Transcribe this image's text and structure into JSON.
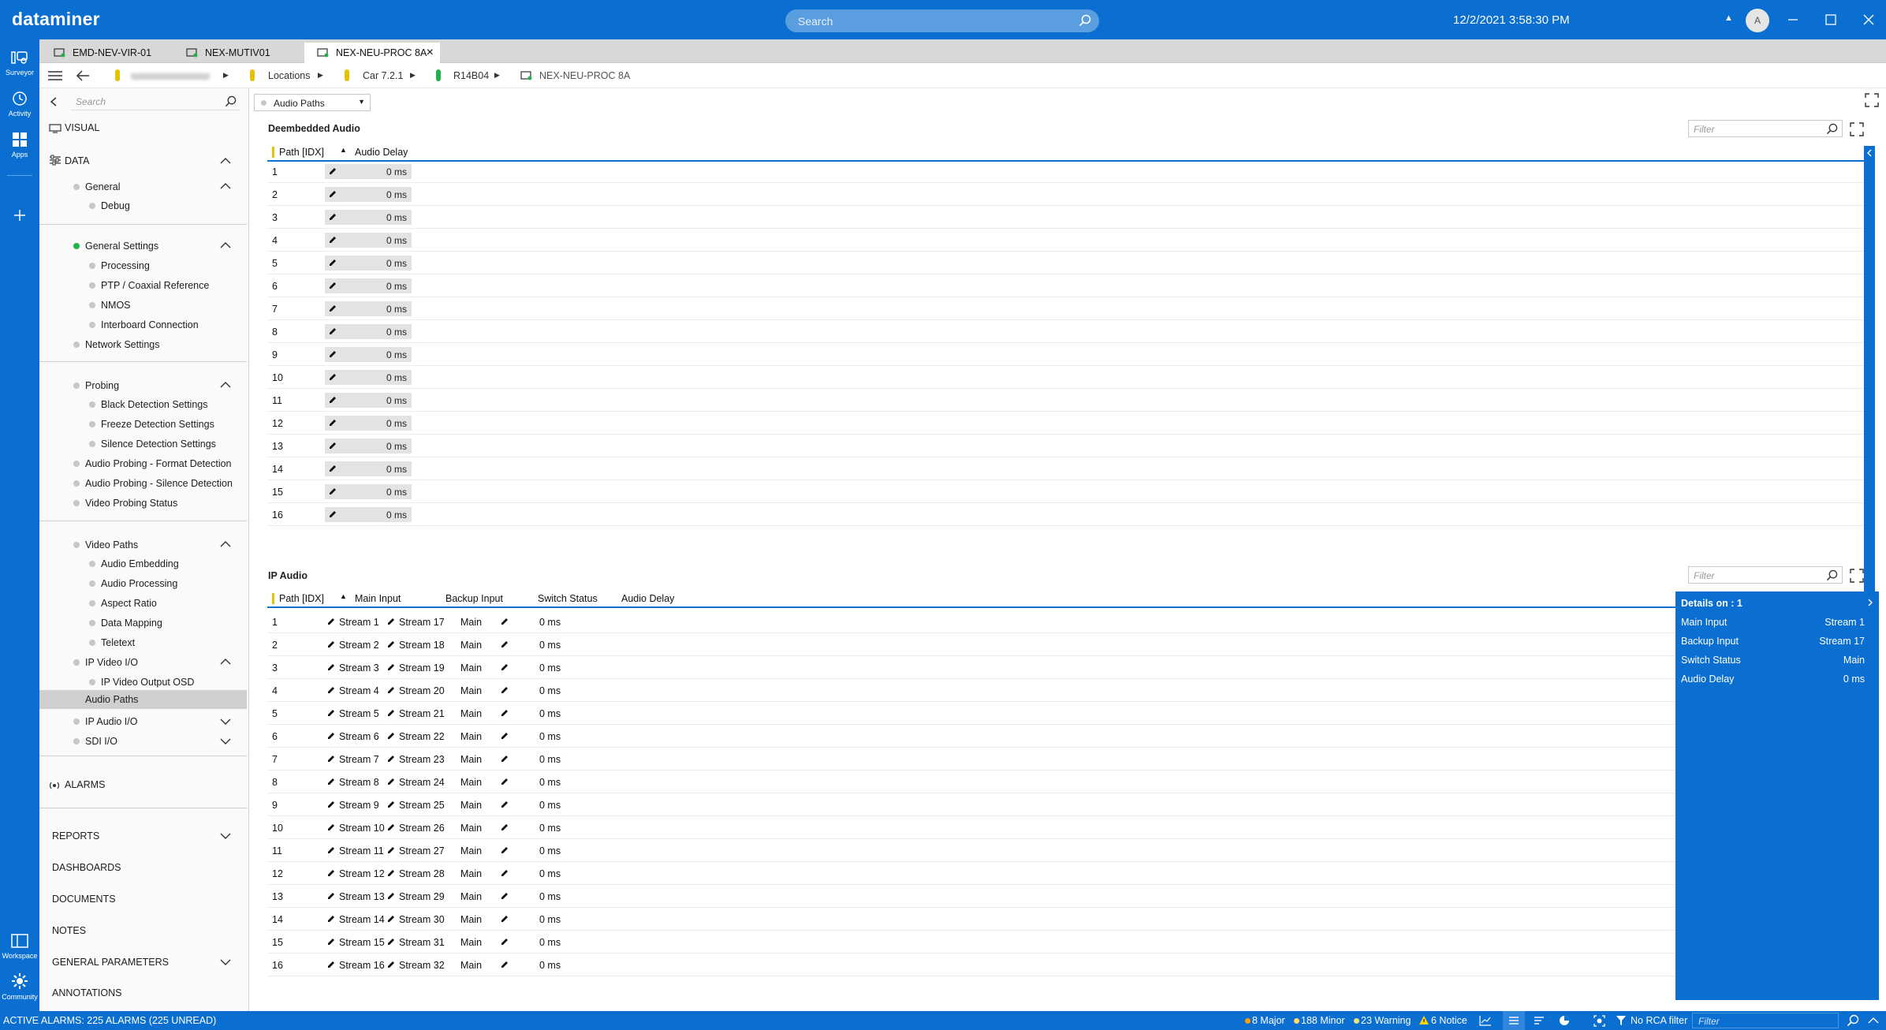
{
  "app": {
    "logo": "dataminer",
    "search_placeholder": "Search",
    "datetime": "12/2/2021 3:58:30 PM",
    "avatar_initial": "A"
  },
  "rail": {
    "top": [
      {
        "label": "Surveyor"
      },
      {
        "label": "Activity"
      },
      {
        "label": "Apps"
      }
    ],
    "bottom": [
      {
        "label": "Workspace"
      },
      {
        "label": "Community"
      }
    ]
  },
  "tabs": [
    {
      "label": "EMD-NEV-VIR-01"
    },
    {
      "label": "NEX-MUTIV01"
    },
    {
      "label": "NEX-NEU-PROC 8A",
      "active": true
    }
  ],
  "breadcrumb": [
    "Locations",
    "Car 7.2.1",
    "R14B04",
    "NEX-NEU-PROC 8A"
  ],
  "nav": {
    "search_placeholder": "Search",
    "visual": "VISUAL",
    "data": "DATA",
    "general": "General",
    "debug": "Debug",
    "general_settings": "General Settings",
    "processing": "Processing",
    "ptp": "PTP / Coaxial Reference",
    "nmos": "NMOS",
    "interboard": "Interboard Connection",
    "network": "Network Settings",
    "probing": "Probing",
    "black": "Black Detection Settings",
    "freeze": "Freeze Detection Settings",
    "silence": "Silence Detection Settings",
    "ap_format": "Audio Probing - Format Detection",
    "ap_silence": "Audio Probing - Silence Detection",
    "vp_status": "Video Probing Status",
    "video_paths": "Video Paths",
    "audio_embedding": "Audio Embedding",
    "audio_processing": "Audio Processing",
    "aspect": "Aspect Ratio",
    "data_mapping": "Data Mapping",
    "teletext": "Teletext",
    "ip_video": "IP Video I/O",
    "ip_video_osd": "IP Video Output OSD",
    "audio_paths": "Audio Paths",
    "ip_audio": "IP Audio I/O",
    "sdi": "SDI I/O",
    "alarms": "ALARMS",
    "reports": "REPORTS",
    "dashboards": "DASHBOARDS",
    "documents": "DOCUMENTS",
    "notes": "NOTES",
    "general_parameters": "GENERAL PARAMETERS",
    "annotations": "ANNOTATIONS"
  },
  "page": {
    "dropdown": "Audio Paths"
  },
  "deembedded": {
    "title": "Deembedded Audio",
    "filter_placeholder": "Filter",
    "col_path": "Path [IDX]",
    "col_delay": "Audio Delay",
    "rows": [
      {
        "idx": "1",
        "delay": "0 ms"
      },
      {
        "idx": "2",
        "delay": "0 ms"
      },
      {
        "idx": "3",
        "delay": "0 ms"
      },
      {
        "idx": "4",
        "delay": "0 ms"
      },
      {
        "idx": "5",
        "delay": "0 ms"
      },
      {
        "idx": "6",
        "delay": "0 ms"
      },
      {
        "idx": "7",
        "delay": "0 ms"
      },
      {
        "idx": "8",
        "delay": "0 ms"
      },
      {
        "idx": "9",
        "delay": "0 ms"
      },
      {
        "idx": "10",
        "delay": "0 ms"
      },
      {
        "idx": "11",
        "delay": "0 ms"
      },
      {
        "idx": "12",
        "delay": "0 ms"
      },
      {
        "idx": "13",
        "delay": "0 ms"
      },
      {
        "idx": "14",
        "delay": "0 ms"
      },
      {
        "idx": "15",
        "delay": "0 ms"
      },
      {
        "idx": "16",
        "delay": "0 ms"
      }
    ]
  },
  "ipaudio": {
    "title": "IP Audio",
    "filter_placeholder": "Filter",
    "col_path": "Path [IDX]",
    "col_main": "Main Input",
    "col_backup": "Backup Input",
    "col_switch": "Switch Status",
    "col_delay": "Audio Delay",
    "rows": [
      {
        "idx": "1",
        "main": "Stream 1",
        "backup": "Stream 17",
        "status": "Main",
        "delay": "0 ms"
      },
      {
        "idx": "2",
        "main": "Stream 2",
        "backup": "Stream 18",
        "status": "Main",
        "delay": "0 ms"
      },
      {
        "idx": "3",
        "main": "Stream 3",
        "backup": "Stream 19",
        "status": "Main",
        "delay": "0 ms"
      },
      {
        "idx": "4",
        "main": "Stream 4",
        "backup": "Stream 20",
        "status": "Main",
        "delay": "0 ms"
      },
      {
        "idx": "5",
        "main": "Stream 5",
        "backup": "Stream 21",
        "status": "Main",
        "delay": "0 ms"
      },
      {
        "idx": "6",
        "main": "Stream 6",
        "backup": "Stream 22",
        "status": "Main",
        "delay": "0 ms"
      },
      {
        "idx": "7",
        "main": "Stream 7",
        "backup": "Stream 23",
        "status": "Main",
        "delay": "0 ms"
      },
      {
        "idx": "8",
        "main": "Stream 8",
        "backup": "Stream 24",
        "status": "Main",
        "delay": "0 ms"
      },
      {
        "idx": "9",
        "main": "Stream 9",
        "backup": "Stream 25",
        "status": "Main",
        "delay": "0 ms"
      },
      {
        "idx": "10",
        "main": "Stream 10",
        "backup": "Stream 26",
        "status": "Main",
        "delay": "0 ms"
      },
      {
        "idx": "11",
        "main": "Stream 11",
        "backup": "Stream 27",
        "status": "Main",
        "delay": "0 ms"
      },
      {
        "idx": "12",
        "main": "Stream 12",
        "backup": "Stream 28",
        "status": "Main",
        "delay": "0 ms"
      },
      {
        "idx": "13",
        "main": "Stream 13",
        "backup": "Stream 29",
        "status": "Main",
        "delay": "0 ms"
      },
      {
        "idx": "14",
        "main": "Stream 14",
        "backup": "Stream 30",
        "status": "Main",
        "delay": "0 ms"
      },
      {
        "idx": "15",
        "main": "Stream 15",
        "backup": "Stream 31",
        "status": "Main",
        "delay": "0 ms"
      },
      {
        "idx": "16",
        "main": "Stream 16",
        "backup": "Stream 32",
        "status": "Main",
        "delay": "0 ms"
      }
    ]
  },
  "details": {
    "header": "Details on : 1",
    "items": [
      {
        "label": "Main Input",
        "value": "Stream 1"
      },
      {
        "label": "Backup Input",
        "value": "Stream 17"
      },
      {
        "label": "Switch Status",
        "value": "Main"
      },
      {
        "label": "Audio Delay",
        "value": "0 ms"
      }
    ]
  },
  "statusbar": {
    "alarms": "ACTIVE ALARMS: 225 ALARMS (225 UNREAD)",
    "major": "8 Major",
    "minor": "188 Minor",
    "warning": "23 Warning",
    "notice": "6 Notice",
    "rca": "No RCA filter",
    "filter_placeholder": "Filter"
  },
  "colors": {
    "brand": "#0a6fd0",
    "major": "#ff9d00",
    "minor": "#ffd966",
    "warning": "#e9e37a",
    "notice": "#ffd400",
    "green": "#22b14c"
  }
}
